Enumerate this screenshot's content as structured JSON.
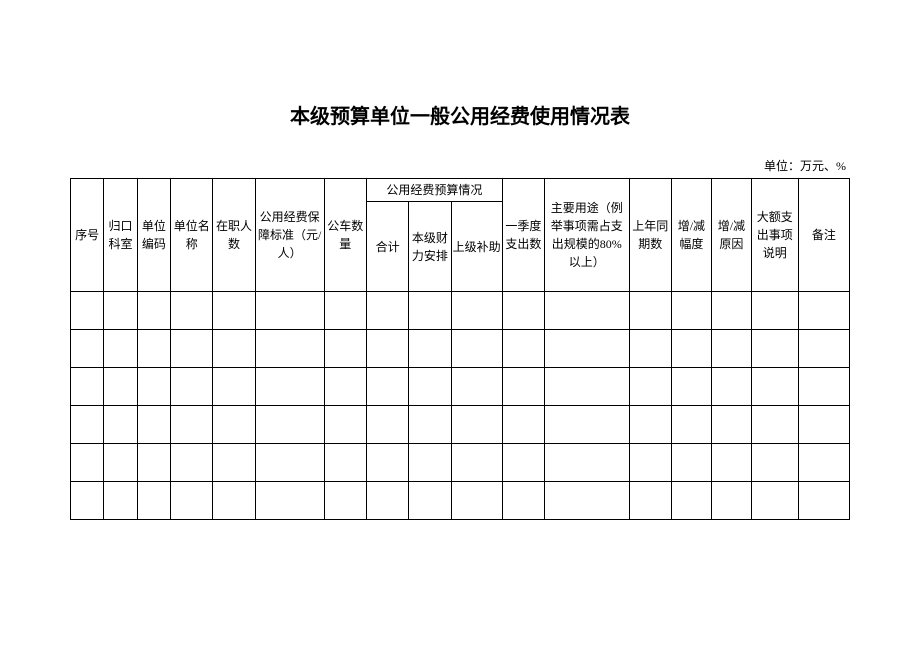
{
  "title": "本级预算单位一般公用经费使用情况表",
  "unit_label": "单位：万元、%",
  "headers": {
    "seq": "序号",
    "dept": "归口科室",
    "code": "单位编码",
    "name": "单位名称",
    "staff": "在职人数",
    "standard": "公用经费保障标准（元/人）",
    "cars": "公车数量",
    "budget_group": "公用经费预算情况",
    "total": "合计",
    "local": "本级财力安排",
    "upper": "上级补助",
    "q1": "一季度支出数",
    "usage": "主要用途（例举事项需占支出规模的80%以上）",
    "prev": "上年同期数",
    "range": "增/减幅度",
    "reason": "增/减原因",
    "large": "大额支出事项说明",
    "remark": "备注"
  },
  "rows": [
    {
      "seq": "",
      "dept": "",
      "code": "",
      "name": "",
      "staff": "",
      "standard": "",
      "cars": "",
      "total": "",
      "local": "",
      "upper": "",
      "q1": "",
      "usage": "",
      "prev": "",
      "range": "",
      "reason": "",
      "large": "",
      "remark": ""
    },
    {
      "seq": "",
      "dept": "",
      "code": "",
      "name": "",
      "staff": "",
      "standard": "",
      "cars": "",
      "total": "",
      "local": "",
      "upper": "",
      "q1": "",
      "usage": "",
      "prev": "",
      "range": "",
      "reason": "",
      "large": "",
      "remark": ""
    },
    {
      "seq": "",
      "dept": "",
      "code": "",
      "name": "",
      "staff": "",
      "standard": "",
      "cars": "",
      "total": "",
      "local": "",
      "upper": "",
      "q1": "",
      "usage": "",
      "prev": "",
      "range": "",
      "reason": "",
      "large": "",
      "remark": ""
    },
    {
      "seq": "",
      "dept": "",
      "code": "",
      "name": "",
      "staff": "",
      "standard": "",
      "cars": "",
      "total": "",
      "local": "",
      "upper": "",
      "q1": "",
      "usage": "",
      "prev": "",
      "range": "",
      "reason": "",
      "large": "",
      "remark": ""
    },
    {
      "seq": "",
      "dept": "",
      "code": "",
      "name": "",
      "staff": "",
      "standard": "",
      "cars": "",
      "total": "",
      "local": "",
      "upper": "",
      "q1": "",
      "usage": "",
      "prev": "",
      "range": "",
      "reason": "",
      "large": "",
      "remark": ""
    },
    {
      "seq": "",
      "dept": "",
      "code": "",
      "name": "",
      "staff": "",
      "standard": "",
      "cars": "",
      "total": "",
      "local": "",
      "upper": "",
      "q1": "",
      "usage": "",
      "prev": "",
      "range": "",
      "reason": "",
      "large": "",
      "remark": ""
    }
  ]
}
